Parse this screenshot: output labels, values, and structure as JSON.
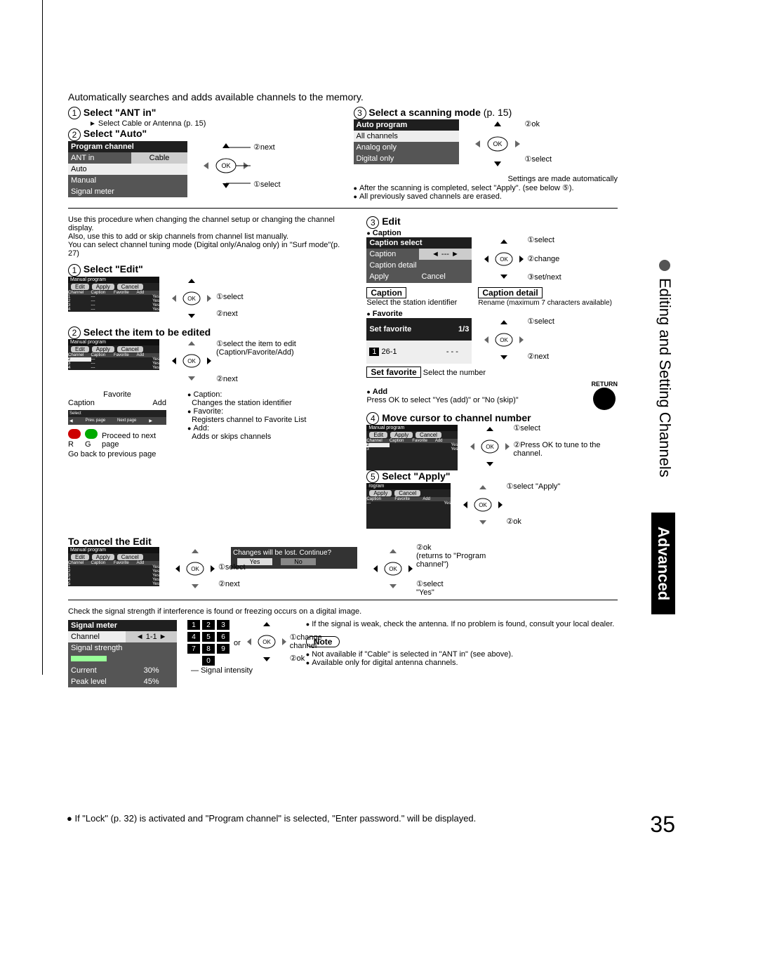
{
  "page_number": "35",
  "side_chapter": "Editing and Setting Channels",
  "side_section": "Advanced",
  "footer_note": "If \"Lock\" (p. 32) is activated and \"Program channel\" is selected, \"Enter password.\" will be displayed.",
  "section_auto": {
    "intro": "Automatically searches and adds available channels to the memory.",
    "step1_title": "Select \"ANT in\"",
    "step1_action": "Select Cable or Antenna (p. 15)",
    "step2_title": "Select \"Auto\"",
    "menu": {
      "title": "Program channel",
      "ant_in": "ANT in",
      "cable": "Cable",
      "auto": "Auto",
      "manual": "Manual",
      "signal_meter": "Signal meter"
    },
    "step2_legend": {
      "next": "next",
      "select": "select"
    },
    "step3_title": "Select a scanning mode",
    "step3_ref": "(p. 15)",
    "scan_menu": {
      "title": "Auto program",
      "all": "All channels",
      "analog": "Analog only",
      "digital": "Digital only"
    },
    "scan_legend": {
      "ok": "ok",
      "select": "select"
    },
    "notes": {
      "auto_set": "Settings are made automatically",
      "after_scan": "After the scanning is completed, select \"Apply\". (see below ⑤).",
      "erased": "All previously saved channels are erased."
    }
  },
  "section_manual": {
    "intro": "Use this procedure when changing the channel setup or changing the channel display.\nAlso, use this to add or skip channels from channel list manually.\nYou can select channel tuning mode (Digital only/Analog only) in \"Surf mode\"(p. 27)",
    "step1_title": "Select \"Edit\"",
    "mini1": {
      "title": "Manual program",
      "buttons": [
        "Edit",
        "Apply",
        "Cancel"
      ],
      "cols": [
        "Channel",
        "Caption",
        "Favorite",
        "Add"
      ],
      "rows": [
        "1",
        "2",
        "3",
        "4"
      ],
      "yes": "Yes"
    },
    "step1_legend": {
      "select": "select",
      "next": "next"
    },
    "step2_title": "Select the item to be edited",
    "step2_legend": {
      "select_item": "select the item to edit (Caption/Favorite/Add)",
      "next": "next"
    },
    "help_favorite": "Favorite",
    "help_caption": "Caption",
    "help_add": "Add",
    "proceed": "Proceed to next page",
    "goback": "Go back to previous page",
    "r_label": "R",
    "g_label": "G",
    "explain_caption_t": "Caption:",
    "explain_caption_b": "Changes the station identifier",
    "explain_favorite_t": "Favorite:",
    "explain_favorite_b": "Registers channel to Favorite List",
    "explain_add_t": "Add:",
    "explain_add_b": "Adds or skips channels",
    "navbar": {
      "select": "Select",
      "prev": "Prev. page",
      "next": "Next page"
    },
    "cancel_title": "To cancel the Edit",
    "mini_cancel_rows": [
      "1",
      "2",
      "3",
      "4",
      "5"
    ],
    "cancel_legend": {
      "select": "select",
      "next": "next"
    }
  },
  "section_edit": {
    "step3_title": "Edit",
    "heading_caption": "Caption",
    "caption_menu": {
      "title": "Caption select",
      "row1": "Caption",
      "row1_val": "---",
      "row2": "Caption detail",
      "apply": "Apply",
      "cancel": "Cancel"
    },
    "cap_legend": {
      "select": "select",
      "change": "change",
      "setnext": "set/next"
    },
    "box_caption": "Caption",
    "box_caption_desc": "Select the station identifier",
    "box_detail": "Caption detail",
    "box_detail_desc": "Rename (maximum 7 characters available)",
    "heading_favorite": "Favorite",
    "fav_menu": {
      "title": "Set favorite",
      "page": "1/3",
      "ch": "26-1",
      "num": "1",
      "val": "- - -"
    },
    "fav_legend": {
      "select": "select",
      "next": "next"
    },
    "box_setfav": "Set favorite",
    "box_setfav_desc": "Select the number",
    "heading_add": "Add",
    "add_desc": "Press OK to select \"Yes (add)\" or \"No (skip)\"",
    "return_label": "RETURN",
    "step4_title": "Move cursor to channel number",
    "step4_legend": {
      "select": "select",
      "press_ok": "Press OK to tune to the channel."
    },
    "tiny4_rows": [
      "2",
      "3"
    ],
    "step5_title": "Select \"Apply\"",
    "tiny5_title": "rogram",
    "step5_legend": {
      "select_apply": "select \"Apply\"",
      "ok": "ok"
    },
    "dialog": {
      "text": "Changes will be lost. Continue?",
      "yes": "Yes",
      "no": "No"
    },
    "dialog_legend": {
      "ok": "ok",
      "returns": "(returns to \"Program channel\")",
      "select_yes": "select \"Yes\""
    }
  },
  "section_signal": {
    "intro": "Check the signal strength if interference is found or freezing occurs on a digital image.",
    "menu": {
      "title": "Signal meter",
      "channel": "Channel",
      "channel_val": "1-1",
      "strength": "Signal strength",
      "current": "Current",
      "current_val": "30%",
      "peak": "Peak level",
      "peak_val": "45%"
    },
    "or": "or",
    "legend": {
      "change": "change channel",
      "ok": "ok"
    },
    "intensity_label": "Signal intensity",
    "bullet_weak": "If the signal is weak, check the antenna. If no problem is found, consult your local dealer.",
    "note_title": "Note",
    "note1": "Not available if \"Cable\" is selected in \"ANT in\" (see above).",
    "note2": "Available only for digital antenna channels."
  },
  "controls": {
    "ok": "OK"
  }
}
